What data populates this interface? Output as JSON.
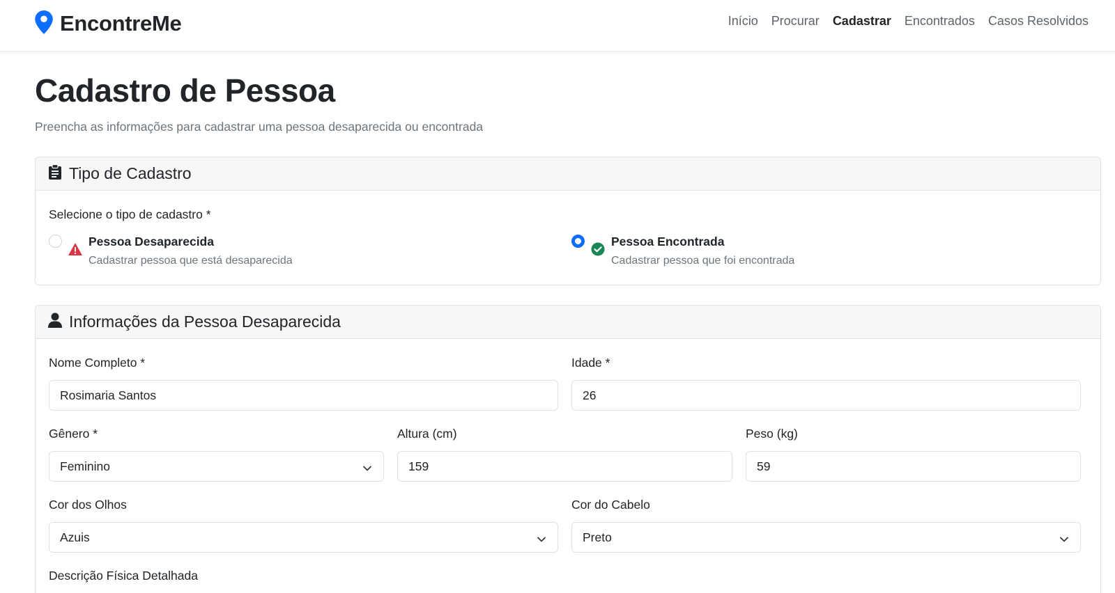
{
  "brand": {
    "name": "EncontreMe",
    "accent": "#0d6efd"
  },
  "nav": {
    "items": [
      {
        "label": "Início",
        "active": false
      },
      {
        "label": "Procurar",
        "active": false
      },
      {
        "label": "Cadastrar",
        "active": true
      },
      {
        "label": "Encontrados",
        "active": false
      },
      {
        "label": "Casos Resolvidos",
        "active": false
      }
    ]
  },
  "page": {
    "title": "Cadastro de Pessoa",
    "subtitle": "Preencha as informações para cadastrar uma pessoa desaparecida ou encontrada"
  },
  "tipo": {
    "title": "Tipo de Cadastro",
    "icon": "clipboard-icon",
    "prompt": "Selecione o tipo de cadastro *",
    "options": [
      {
        "title": "Pessoa Desaparecida",
        "desc": "Cadastrar pessoa que está desaparecida",
        "icon": "warning-triangle-icon",
        "color": "#dc3545",
        "checked": false
      },
      {
        "title": "Pessoa Encontrada",
        "desc": "Cadastrar pessoa que foi encontrada",
        "icon": "check-circle-icon",
        "color": "#198754",
        "checked": true
      }
    ]
  },
  "info": {
    "title": "Informações da Pessoa Desaparecida",
    "icon": "person-icon",
    "fields": {
      "nome": {
        "label": "Nome Completo *",
        "value": "Rosimaria Santos"
      },
      "idade": {
        "label": "Idade *",
        "value": "26"
      },
      "genero": {
        "label": "Gênero *",
        "value": "Feminino"
      },
      "altura": {
        "label": "Altura (cm)",
        "value": "159"
      },
      "peso": {
        "label": "Peso (kg)",
        "value": "59"
      },
      "olhos": {
        "label": "Cor dos Olhos",
        "value": "Azuis"
      },
      "cabelo": {
        "label": "Cor do Cabelo",
        "value": "Preto"
      },
      "descricao": {
        "label": "Descrição Física Detalhada"
      }
    }
  }
}
